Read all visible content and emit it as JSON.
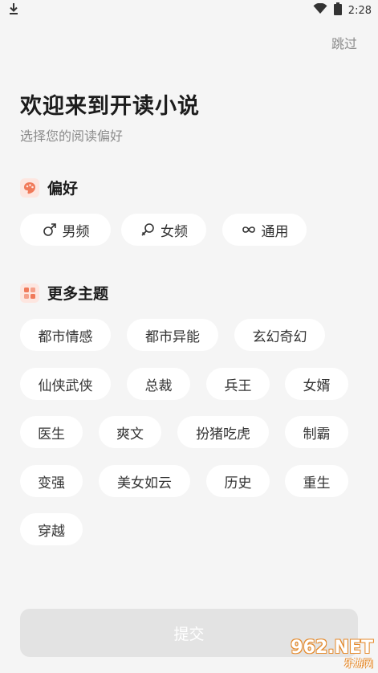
{
  "status_bar": {
    "time": "2:28"
  },
  "header": {
    "skip_label": "跳过",
    "title": "欢迎来到开读小说",
    "subtitle": "选择您的阅读偏好"
  },
  "preference": {
    "title": "偏好",
    "options": [
      {
        "label": "男频",
        "icon": "male-icon"
      },
      {
        "label": "女频",
        "icon": "female-icon"
      },
      {
        "label": "通用",
        "icon": "infinity-icon"
      }
    ]
  },
  "themes": {
    "title": "更多主题",
    "items": [
      "都市情感",
      "都市异能",
      "玄幻奇幻",
      "仙侠武侠",
      "总裁",
      "兵王",
      "女婿",
      "医生",
      "爽文",
      "扮猪吃虎",
      "制霸",
      "变强",
      "美女如云",
      "历史",
      "重生",
      "穿越"
    ]
  },
  "submit_label": "提交",
  "watermark": {
    "top": "962.NET",
    "bottom": "乐游网"
  },
  "colors": {
    "background": "#f5f5f5",
    "chip": "#ffffff",
    "accent_icon": "#f07a5a",
    "submit_disabled": "#e3e3e3"
  }
}
